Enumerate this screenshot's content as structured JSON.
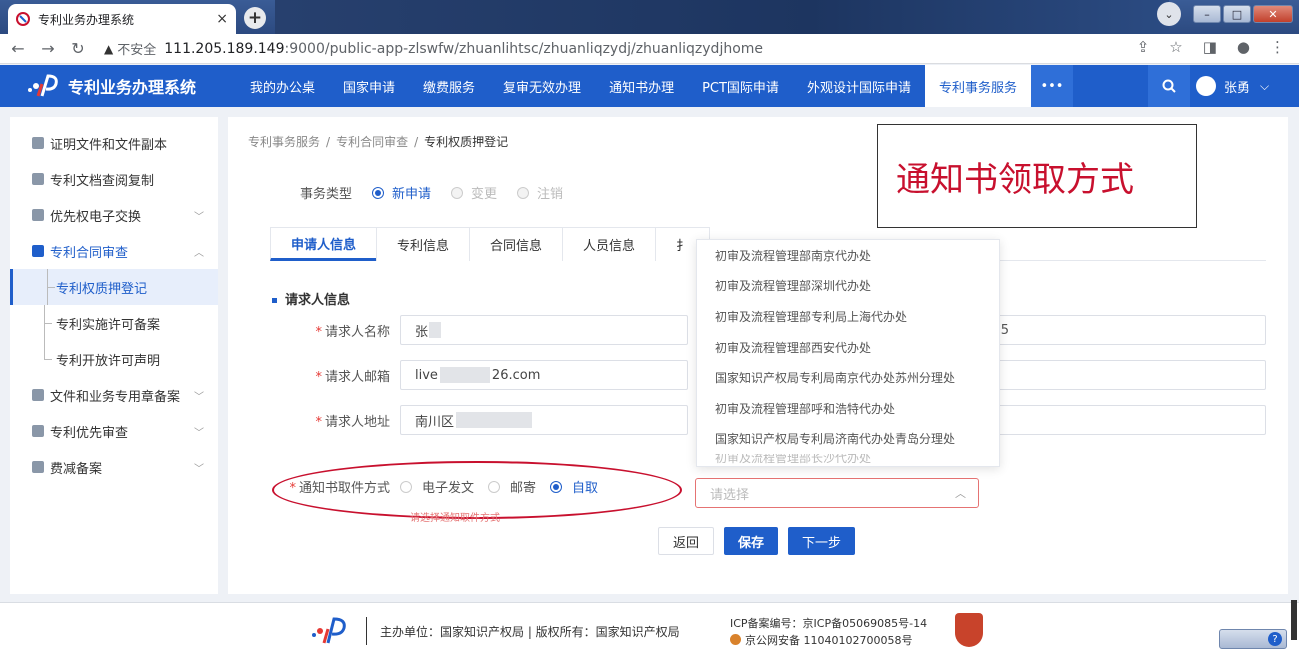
{
  "browser": {
    "tab_title": "专利业务办理系统",
    "tab_close": "×",
    "new_tab": "+",
    "secure_label": "不安全",
    "url_host": "111.205.189.149",
    "url_rest": ":9000/public-app-zlswfw/zhuanlihtsc/zhuanliqzydj/zhuanliqzydjhome"
  },
  "app": {
    "name": "专利业务办理系统",
    "menu": [
      "我的办公桌",
      "国家申请",
      "缴费服务",
      "复审无效办理",
      "通知书办理",
      "PCT国际申请",
      "外观设计国际申请",
      "专利事务服务"
    ],
    "more": "•••",
    "user_name": "张勇",
    "user_chevron": "⌵"
  },
  "sidebar": {
    "items": [
      {
        "label": "证明文件和文件副本",
        "chevron": ""
      },
      {
        "label": "专利文档查阅复制",
        "chevron": ""
      },
      {
        "label": "优先权电子交换",
        "chevron": "﹀"
      },
      {
        "label": "专利合同审查",
        "chevron": "︿"
      }
    ],
    "subitems": [
      "专利权质押登记",
      "专利实施许可备案",
      "专利开放许可声明"
    ],
    "items2": [
      {
        "label": "文件和业务专用章备案",
        "chevron": "﹀"
      },
      {
        "label": "专利优先审查",
        "chevron": "﹀"
      },
      {
        "label": "费减备案",
        "chevron": "﹀"
      }
    ]
  },
  "breadcrumb": [
    "专利事务服务",
    "专利合同审查",
    "专利权质押登记"
  ],
  "breadcrumb_sep": "/",
  "task_type": {
    "label": "事务类型",
    "options": [
      "新申请",
      "变更",
      "注销"
    ]
  },
  "tabs": [
    "申请人信息",
    "专利信息",
    "合同信息",
    "人员信息",
    "扌"
  ],
  "section_title": "请求人信息",
  "fields": {
    "name_label": "请求人名称",
    "name_value": "张",
    "email_label": "请求人邮箱",
    "email_value_a": "live",
    "email_value_b": "26.com",
    "address_label": "请求人地址",
    "address_value": "南川区",
    "right_partial": "5",
    "required_mark": "*"
  },
  "notice": {
    "label": "通知书取件方式",
    "options": [
      "电子发文",
      "邮寄",
      "自取"
    ],
    "error": "请选择通知取件方式",
    "select_placeholder": "请选择",
    "select_arrow": "︿"
  },
  "dropdown_options": [
    "初审及流程管理部南京代办处",
    "初审及流程管理部深圳代办处",
    "初审及流程管理部专利局上海代办处",
    "初审及流程管理部西安代办处",
    "国家知识产权局专利局南京代办处苏州分理处",
    "初审及流程管理部呼和浩特代办处",
    "国家知识产权局专利局济南代办处青岛分理处",
    "初审及流程管理部长沙代办处"
  ],
  "buttons": {
    "back": "返回",
    "save": "保存",
    "next": "下一步"
  },
  "callout": "通知书领取方式",
  "footer": {
    "org": "主办单位：国家知识产权局 | 版权所有：国家知识产权局",
    "icp": "ICP备案编号：京ICP备05069085号-14",
    "police": "京公网安备 11040102700058号"
  },
  "colors": {
    "brand": "#1f5eca",
    "alert": "#c8102e"
  }
}
